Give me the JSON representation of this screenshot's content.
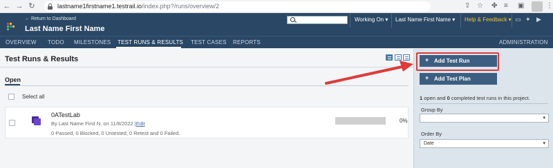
{
  "browser": {
    "url_host": "lastname1firstname1.testrail.io",
    "url_path": "/index.php?/runs/overview/2"
  },
  "header": {
    "return_link": "← Return to Dashboard",
    "project_name": "Last Name First Name",
    "working_on": "Working On",
    "user_menu": "Last Name First Name",
    "help_feedback": "Help & Feedback",
    "logo_colors": [
      "#e0443a",
      "#f2c230",
      "#5fb85a",
      "#3a8fd6"
    ]
  },
  "nav": {
    "tabs": [
      {
        "label": "OVERVIEW"
      },
      {
        "label": "TODO"
      },
      {
        "label": "MILESTONES"
      },
      {
        "label": "TEST RUNS & RESULTS",
        "active": true
      },
      {
        "label": "TEST CASES"
      },
      {
        "label": "REPORTS"
      }
    ],
    "administration": "ADMINISTRATION"
  },
  "main": {
    "title": "Test Runs & Results",
    "section": "Open",
    "select_all": "Select all",
    "runs": [
      {
        "title": "0ATestLab",
        "meta_prefix": "By Last Name First N. on 11/8/2022 |",
        "edit": "Edit",
        "stats": "0 Passed, 0 Blocked, 0 Untested, 0 Retest and 0 Failed.",
        "progress_fraction": 0,
        "percent": "0%"
      }
    ]
  },
  "sidebar": {
    "add_run": "Add Test Run",
    "add_plan": "Add Test Plan",
    "summary": {
      "open_count": "1",
      "mid": " open and ",
      "completed_count": "0",
      "tail": " completed test runs in this project."
    },
    "group_by_label": "Group By",
    "group_by_value": "",
    "order_by_label": "Order By",
    "order_by_value": "Date"
  },
  "annotation": {
    "arrow_color": "#e03a3a"
  }
}
